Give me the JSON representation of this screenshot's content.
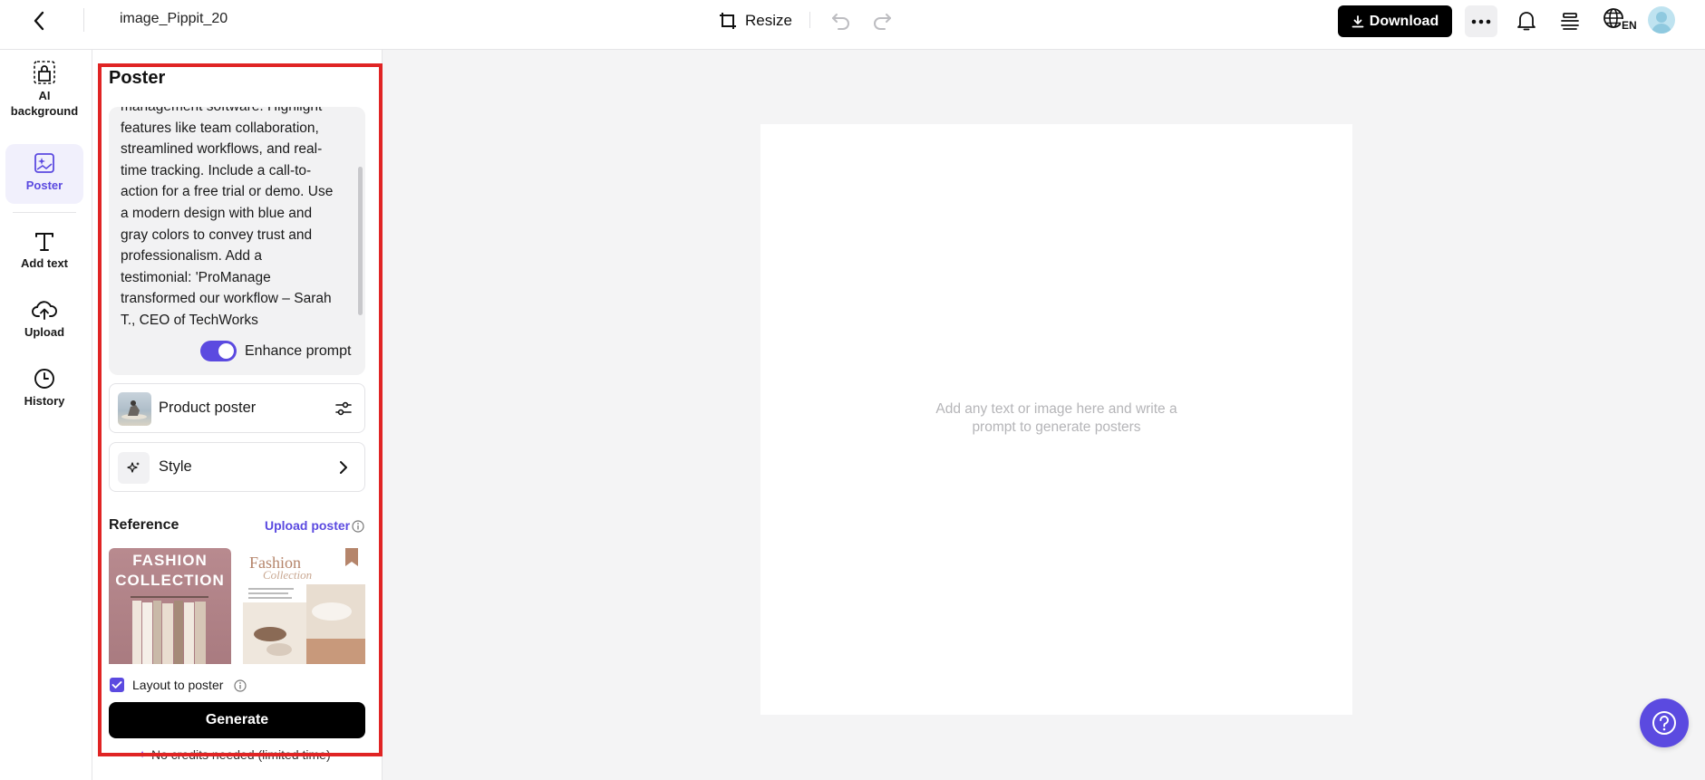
{
  "topbar": {
    "doc_title": "image_Pippit_20",
    "resize_label": "Resize",
    "download_label": "Download",
    "lang_code": "EN"
  },
  "nav": {
    "items": [
      {
        "label": "AI background",
        "icon": "ai-background-icon"
      },
      {
        "label": "Poster",
        "icon": "poster-icon",
        "active": true
      },
      {
        "label": "Add text",
        "icon": "text-icon"
      },
      {
        "label": "Upload",
        "icon": "upload-cloud-icon"
      },
      {
        "label": "History",
        "icon": "clock-icon"
      }
    ]
  },
  "panel": {
    "title": "Poster",
    "prompt_text": "management software. Highlight\nfeatures like team collaboration,\nstreamlined workflows, and real-\ntime tracking. Include a call-to-\naction for a free trial or demo. Use\na modern design with blue and\ngray colors to convey trust and\nprofessionalism. Add a\ntestimonial: 'ProManage\ntransformed our workflow – Sarah\nT., CEO of TechWorks",
    "enhance_label": "Enhance prompt",
    "enhance_on": true,
    "product_label": "Product poster",
    "style_label": "Style",
    "reference_label": "Reference",
    "upload_poster_label": "Upload poster",
    "ref1": {
      "line1": "FASHION",
      "line2": "COLLECTION"
    },
    "ref2": {
      "line1": "Fashion",
      "line2": "Collection"
    },
    "layout_label": "Layout to poster",
    "layout_checked": true,
    "generate_label": "Generate",
    "credits_text": "No credits needed (limited time)"
  },
  "canvas": {
    "hint": "Add any text or image here and write a\nprompt to generate posters"
  },
  "colors": {
    "accent": "#5b4ae0",
    "highlight": "#e02424"
  }
}
